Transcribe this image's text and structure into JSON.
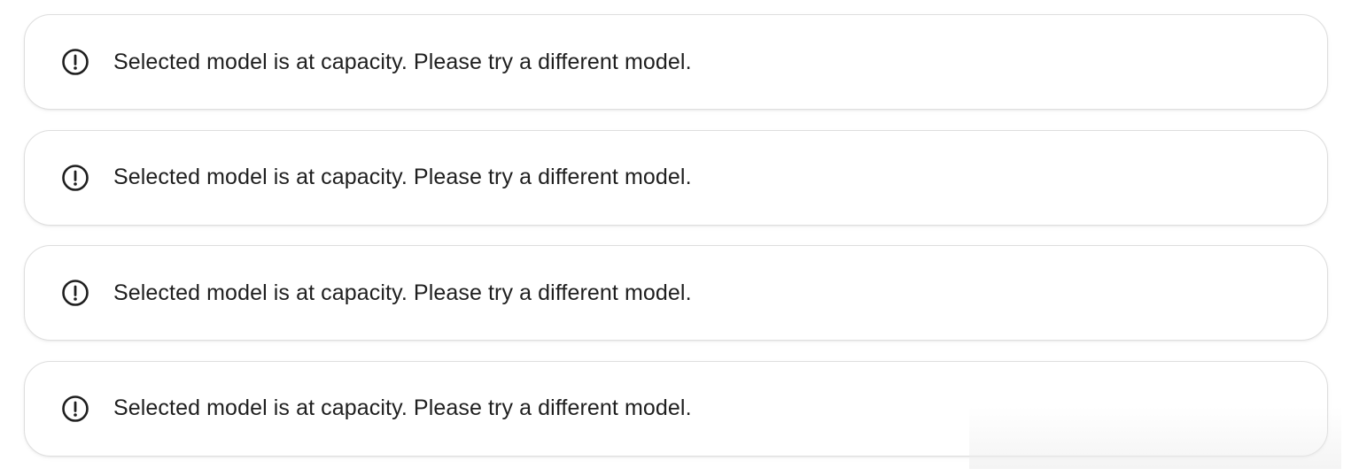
{
  "alerts": [
    {
      "icon": "alert-circle-icon",
      "message": "Selected model is at capacity. Please try a different model."
    },
    {
      "icon": "alert-circle-icon",
      "message": "Selected model is at capacity. Please try a different model."
    },
    {
      "icon": "alert-circle-icon",
      "message": "Selected model is at capacity. Please try a different model."
    },
    {
      "icon": "alert-circle-icon",
      "message": "Selected model is at capacity. Please try a different model."
    }
  ],
  "colors": {
    "text": "#1f1f1f",
    "icon": "#1f1f1f",
    "card_border": "#dedede",
    "background": "#ffffff"
  }
}
